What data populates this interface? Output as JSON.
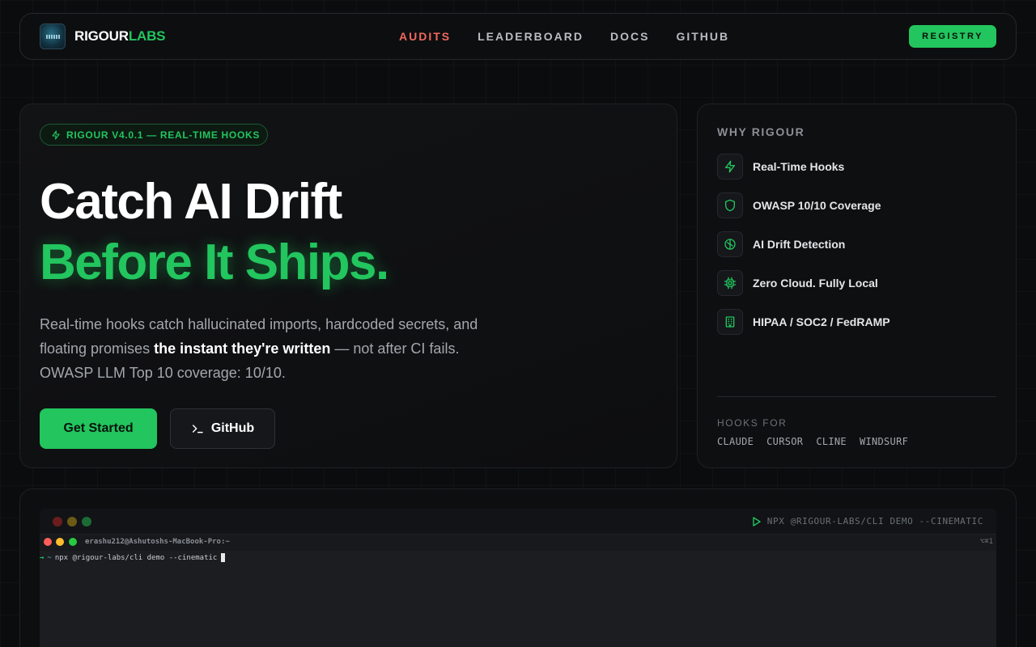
{
  "brand": {
    "name_part1": "RIGOUR",
    "name_part2": "LABS"
  },
  "nav": {
    "links": [
      "AUDITS",
      "LEADERBOARD",
      "DOCS",
      "GITHUB"
    ],
    "active": "AUDITS",
    "cta": "REGISTRY"
  },
  "hero": {
    "badge": "RIGOUR V4.0.1 — REAL-TIME HOOKS",
    "headline_line1": "Catch AI Drift",
    "headline_line2": "Before It Ships.",
    "desc_part1": "Real-time hooks catch hallucinated imports, hardcoded secrets, and floating promises ",
    "desc_bold": "the instant they're written",
    "desc_part2": " — not after CI fails. OWASP LLM Top 10 coverage: 10/10.",
    "primary_button": "Get Started",
    "secondary_button": "GitHub"
  },
  "sidebar": {
    "title": "WHY RIGOUR",
    "features": [
      {
        "label": "Real-Time Hooks",
        "icon": "bolt-icon"
      },
      {
        "label": "OWASP 10/10 Coverage",
        "icon": "shield-icon"
      },
      {
        "label": "AI Drift Detection",
        "icon": "brain-icon"
      },
      {
        "label": "Zero Cloud. Fully Local",
        "icon": "chip-icon"
      },
      {
        "label": "HIPAA / SOC2 / FedRAMP",
        "icon": "building-icon"
      }
    ],
    "hooks_title": "HOOKS FOR",
    "hooks": [
      "CLAUDE",
      "CURSOR",
      "CLINE",
      "WINDSURF"
    ]
  },
  "terminal": {
    "command_label": "NPX @RIGOUR-LABS/CLI DEMO --CINEMATIC",
    "inner_title": "erashu212@Ashutoshs-MacBook-Pro:~",
    "inner_shortcut": "⌥⌘1",
    "prompt_arrow": "→",
    "prompt_tilde": "~",
    "prompt_command": "npx @rigour-labs/cli demo --cinematic"
  },
  "colors": {
    "accent": "#22c55e",
    "active_link": "#f0695e",
    "background": "#0b0c0d"
  }
}
